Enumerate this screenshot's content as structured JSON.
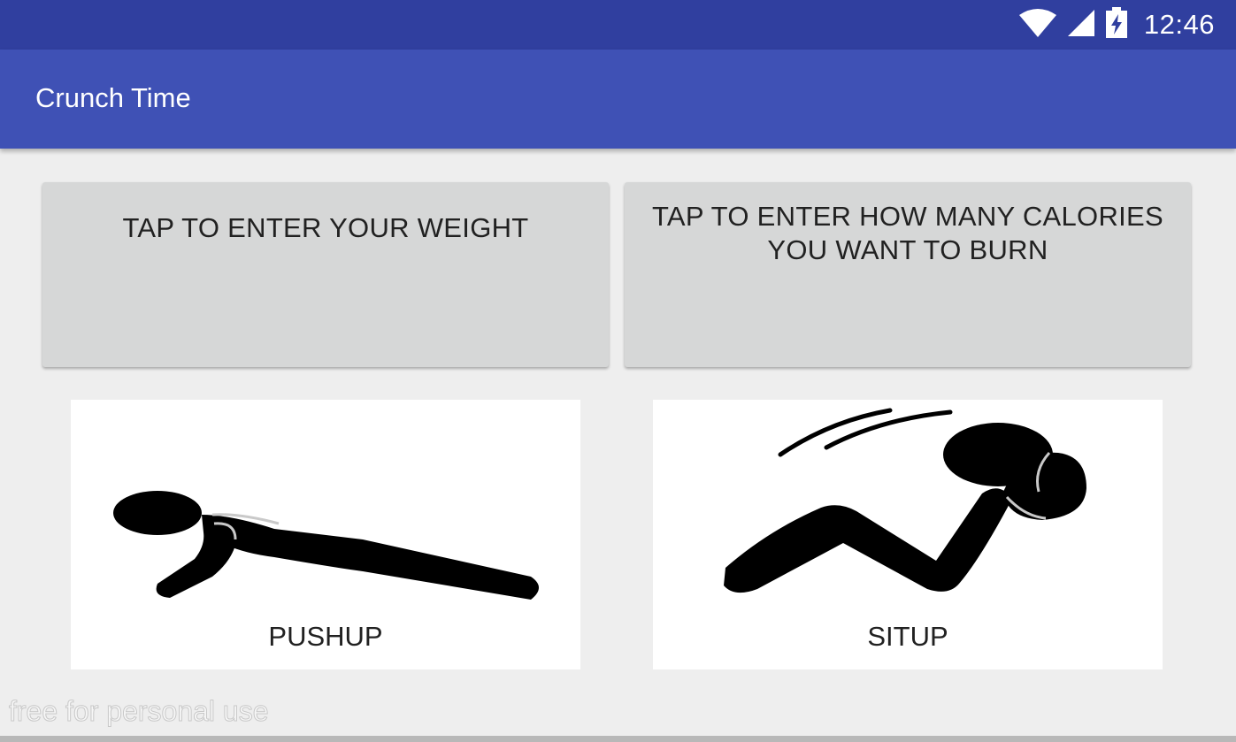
{
  "status_bar": {
    "time": "12:46",
    "icons": [
      "wifi-icon",
      "cell-signal-icon",
      "battery-charging-icon"
    ]
  },
  "app_bar": {
    "title": "Crunch Time"
  },
  "inputs": {
    "weight_label": "TAP TO ENTER YOUR WEIGHT",
    "calories_label": "TAP TO ENTER HOW MANY CALORIES YOU WANT TO BURN"
  },
  "exercises": [
    {
      "label": "PUSHUP",
      "icon": "pushup-icon"
    },
    {
      "label": "SITUP",
      "icon": "situp-icon"
    }
  ],
  "watermark": "free for personal use",
  "colors": {
    "status_bar": "#303f9f",
    "app_bar": "#3f51b5",
    "background": "#eeeeee",
    "button": "#d6d7d7"
  }
}
